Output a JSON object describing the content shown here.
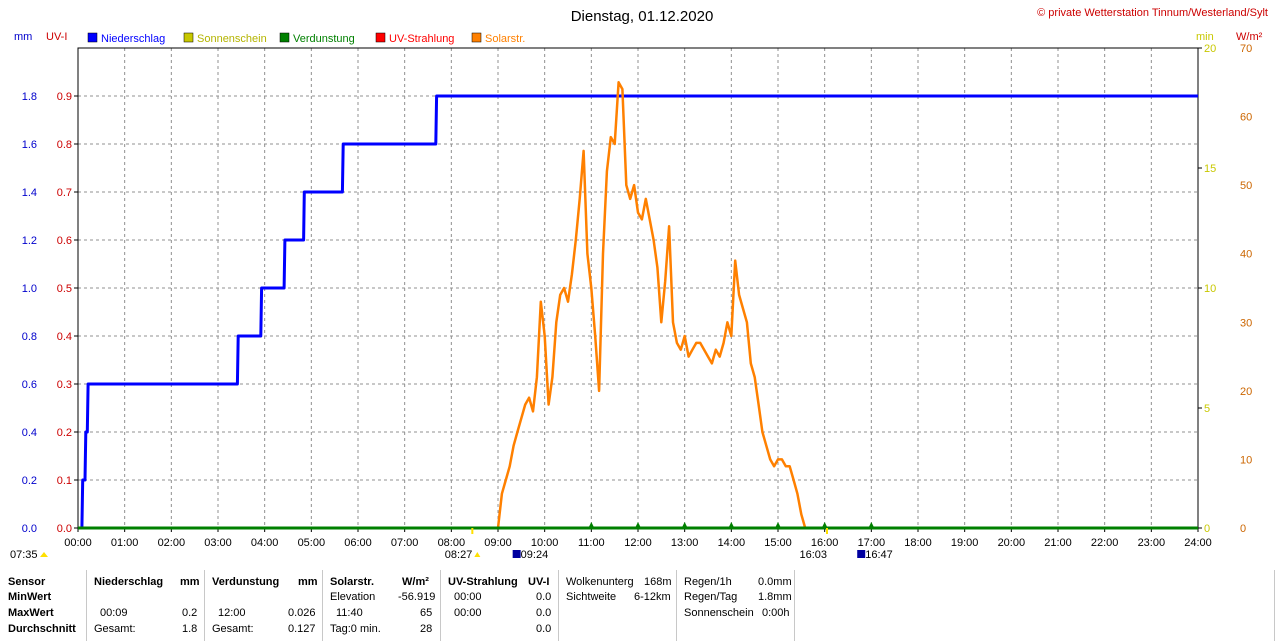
{
  "chart_data": {
    "type": "line",
    "title": "Dienstag, 01.12.2020",
    "credit": "© private Wetterstation Tinnum/Westerland/Sylt",
    "left_units": [
      "mm",
      "UV-I"
    ],
    "right_units": [
      "min",
      "W/m²"
    ],
    "legend": [
      {
        "name": "Niederschlag",
        "color": "#0000ff"
      },
      {
        "name": "Sonnenschein",
        "color": "#c8c800"
      },
      {
        "name": "Verdunstung",
        "color": "#008000"
      },
      {
        "name": "UV-Strahlung",
        "color": "#ff0000"
      },
      {
        "name": "Solarstr.",
        "color": "#ff8000"
      }
    ],
    "x_ticks": [
      "00:00",
      "01:00",
      "02:00",
      "03:00",
      "04:00",
      "05:00",
      "06:00",
      "07:00",
      "08:00",
      "09:00",
      "10:00",
      "11:00",
      "12:00",
      "13:00",
      "14:00",
      "15:00",
      "16:00",
      "17:00",
      "18:00",
      "19:00",
      "20:00",
      "21:00",
      "22:00",
      "23:00",
      "24:00"
    ],
    "y_mm_ticks": [
      "0.0",
      "0.2",
      "0.4",
      "0.6",
      "0.8",
      "1.0",
      "1.2",
      "1.4",
      "1.6",
      "1.8"
    ],
    "y_mm_range": [
      0,
      2.0
    ],
    "y_uv_ticks": [
      "0.0",
      "0.1",
      "0.2",
      "0.3",
      "0.4",
      "0.5",
      "0.6",
      "0.7",
      "0.8",
      "0.9"
    ],
    "y_uv_range": [
      0,
      1.0
    ],
    "y_min_ticks": [
      "0",
      "5",
      "10",
      "15",
      "20"
    ],
    "y_min_range": [
      0,
      20
    ],
    "y_wm2_ticks": [
      "0",
      "10",
      "20",
      "30",
      "40",
      "50",
      "60",
      "70"
    ],
    "y_wm2_range": [
      0,
      70
    ],
    "grid": true,
    "markers": {
      "sunrise": "08:27",
      "sunset": "16:03",
      "left_label": "07:35",
      "moon_a": "09:24",
      "moon_b": "16:47"
    },
    "series": [
      {
        "name": "Niederschlag",
        "unit": "mm",
        "x": [
          "00:00",
          "00:05",
          "00:06",
          "00:09",
          "00:10",
          "00:12",
          "00:13",
          "00:15",
          "00:16",
          "03:25",
          "03:26",
          "03:55",
          "03:56",
          "04:25",
          "04:26",
          "04:50",
          "04:51",
          "05:40",
          "05:41",
          "07:40",
          "07:41",
          "24:00"
        ],
        "values": [
          0,
          0,
          0.2,
          0.2,
          0.4,
          0.4,
          0.6,
          0.6,
          0.6,
          0.6,
          0.8,
          0.8,
          1.0,
          1.0,
          1.2,
          1.2,
          1.4,
          1.4,
          1.6,
          1.6,
          1.8,
          1.8
        ]
      },
      {
        "name": "Solarstr.",
        "unit": "W/m²",
        "x": [
          "09:00",
          "09:05",
          "09:10",
          "09:15",
          "09:20",
          "09:25",
          "09:30",
          "09:35",
          "09:40",
          "09:45",
          "09:50",
          "09:55",
          "10:00",
          "10:05",
          "10:10",
          "10:15",
          "10:20",
          "10:25",
          "10:30",
          "10:35",
          "10:40",
          "10:45",
          "10:50",
          "10:55",
          "11:00",
          "11:05",
          "11:10",
          "11:15",
          "11:20",
          "11:25",
          "11:30",
          "11:35",
          "11:40",
          "11:45",
          "11:50",
          "11:55",
          "12:00",
          "12:05",
          "12:10",
          "12:15",
          "12:20",
          "12:25",
          "12:30",
          "12:35",
          "12:40",
          "12:45",
          "12:50",
          "12:55",
          "13:00",
          "13:05",
          "13:10",
          "13:15",
          "13:20",
          "13:25",
          "13:30",
          "13:35",
          "13:40",
          "13:45",
          "13:50",
          "13:55",
          "14:00",
          "14:05",
          "14:10",
          "14:15",
          "14:20",
          "14:25",
          "14:30",
          "14:35",
          "14:40",
          "14:45",
          "14:50",
          "14:55",
          "15:00",
          "15:05",
          "15:10",
          "15:15",
          "15:20",
          "15:25",
          "15:30",
          "15:35",
          "15:40",
          "15:45"
        ],
        "values": [
          0,
          5,
          7,
          9,
          12,
          14,
          16,
          18,
          19,
          17,
          22,
          33,
          28,
          18,
          22,
          30,
          34,
          35,
          33,
          37,
          42,
          48,
          55,
          40,
          35,
          28,
          20,
          40,
          52,
          57,
          56,
          65,
          64,
          50,
          48,
          50,
          46,
          45,
          48,
          45,
          42,
          38,
          30,
          36,
          44,
          30,
          27,
          26,
          28,
          25,
          26,
          27,
          27,
          26,
          25,
          24,
          26,
          25,
          27,
          30,
          28,
          39,
          34,
          32,
          30,
          24,
          22,
          18,
          14,
          12,
          10,
          9,
          10,
          10,
          9,
          9,
          7,
          5,
          2,
          0,
          0,
          0
        ]
      },
      {
        "name": "Verdunstung",
        "unit": "mm",
        "x": [
          "00:00",
          "24:00"
        ],
        "values": [
          0,
          0
        ]
      }
    ]
  },
  "stats": {
    "headers": {
      "sensor": "Sensor",
      "niederschlag": "Niederschlag",
      "niederschlag_unit": "mm",
      "verdunstung": "Verdunstung",
      "verdunstung_unit": "mm",
      "solar": "Solarstr.",
      "solar_unit": "W/m²",
      "uv": "UV-Strahlung",
      "uv_unit": "UV-I"
    },
    "rows": {
      "min": "MinWert",
      "max": "MaxWert",
      "avg": "Durchschnitt"
    },
    "niederschlag": {
      "max_time": "00:09",
      "max_val": "0.2",
      "total_label": "Gesamt:",
      "total": "1.8"
    },
    "verdunstung": {
      "max_time": "12:00",
      "max_val": "0.026",
      "total_label": "Gesamt:",
      "total": "0.127"
    },
    "solar": {
      "elev_label": "Elevation",
      "elev_val": "-56.919",
      "max_time": "11:40",
      "max_val": "65",
      "tag_label": "Tag:0 min.",
      "avg_val": "28"
    },
    "uv": {
      "min_time": "00:00",
      "min_val": "0.0",
      "max_time": "00:00",
      "max_val": "0.0",
      "avg_val": "0.0"
    },
    "wolken": {
      "label1": "Wolkenunterg",
      "val1": "168m",
      "label2": "Sichtweite",
      "val2": "6-12km"
    },
    "regen": {
      "label1": "Regen/1h",
      "val1": "0.0mm",
      "label2": "Regen/Tag",
      "val2": "1.8mm",
      "label3": "Sonnenschein",
      "val3": "0:00h"
    }
  }
}
